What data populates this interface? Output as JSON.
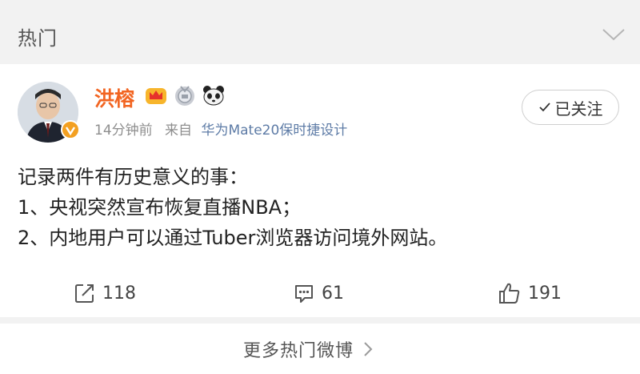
{
  "section": {
    "title": "热门",
    "collapse_icon": "chevron-down-icon"
  },
  "post": {
    "author": {
      "name": "洪榕",
      "verified_icon": "verified-v-badge",
      "badges": [
        "crown-icon",
        "medal-icon",
        "panda-icon"
      ]
    },
    "time": "14分钟前",
    "from_label": "来自",
    "source": "华为Mate20保时捷设计",
    "follow_label": "已关注",
    "lines": [
      "记录两件有历史意义的事：",
      "1、央视突然宣布恢复直播NBA；",
      "2、内地用户可以通过Tuber浏览器访问境外网站。"
    ]
  },
  "actions": {
    "repost_count": "118",
    "comment_count": "61",
    "like_count": "191"
  },
  "more": {
    "label": "更多热门微博"
  },
  "colors": {
    "username": "#f26522",
    "source_link": "#5d7ba6",
    "background": "#f2f2f2"
  }
}
